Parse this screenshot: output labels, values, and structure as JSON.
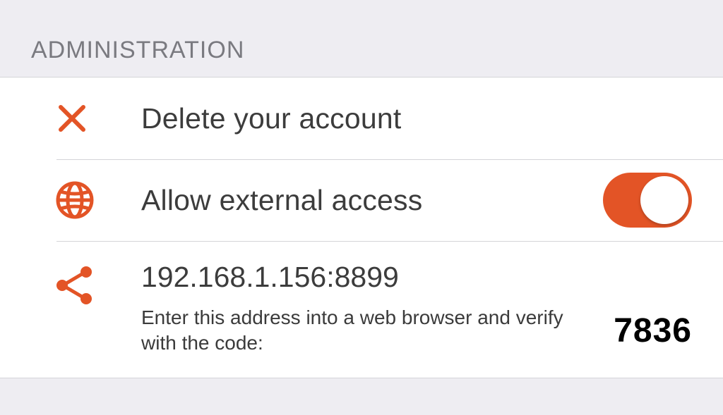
{
  "colors": {
    "accent": "#e35426"
  },
  "section": {
    "title": "ADMINISTRATION"
  },
  "rows": {
    "delete": {
      "label": "Delete your account",
      "icon": "close"
    },
    "external": {
      "label": "Allow external access",
      "icon": "globe",
      "toggle_on": true
    },
    "share": {
      "icon": "share",
      "address": "192.168.1.156:8899",
      "instruction": "Enter this address into a web browser and verify with the code:",
      "code": "7836"
    }
  }
}
